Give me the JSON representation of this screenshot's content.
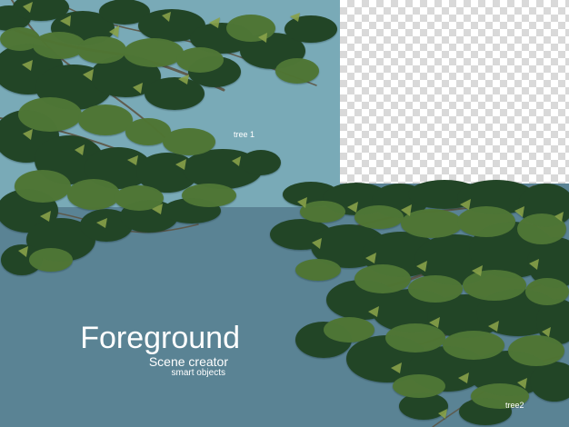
{
  "labels": {
    "tree_1": "tree 1",
    "tree_2": "tree2"
  },
  "title": {
    "main": "Foreground",
    "subtitle": "Scene creator",
    "subsubtitle": "smart objects"
  },
  "colors": {
    "sky_panel": "#79aab7",
    "bottom_panel": "#5a8394",
    "checker_light": "#ffffff",
    "checker_dark": "#d9d9d9",
    "leaf_dark": "#244428",
    "leaf_mid": "#4f7635",
    "leaf_light": "#8aa34a",
    "branch": "#5e5544"
  }
}
